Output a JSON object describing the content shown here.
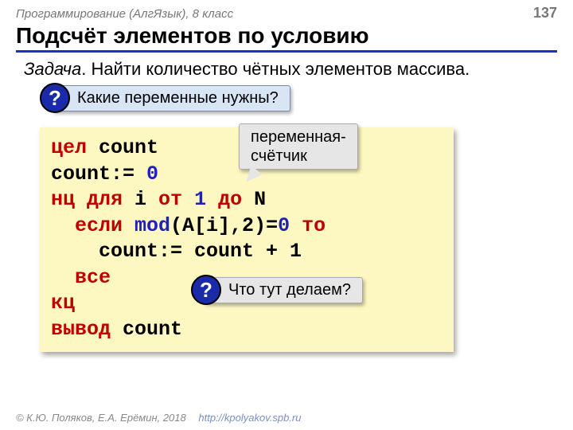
{
  "header": {
    "course": "Программирование (АлгЯзык), 8 класс",
    "page": "137"
  },
  "title": "Подсчёт элементов по условию",
  "task": {
    "label": "Задача",
    "text": ". Найти количество чётных элементов массива."
  },
  "callouts": {
    "q_glyph": "?",
    "c1_text": "Какие переменные нужны?",
    "c2_line1": "переменная-",
    "c2_line2": "счётчик",
    "c3_text": "Что тут делаем?"
  },
  "code": {
    "l1_kw": "цел ",
    "l1_rest": "count",
    "l2_a": "count:= ",
    "l2_b": "0",
    "l3_a": "нц для ",
    "l3_b": "i ",
    "l3_c": "от ",
    "l3_d": "1 ",
    "l3_e": "до ",
    "l3_f": "N",
    "l4_a": "  если ",
    "l4_b": "mod",
    "l4_c": "(A[i],2)=",
    "l4_d": "0",
    "l4_e": " то",
    "l5": "    count:= count + 1",
    "l6": "  все",
    "l7": "кц",
    "l8_a": "вывод ",
    "l8_b": "count"
  },
  "footer": {
    "copyright": "© К.Ю. Поляков, Е.А. Ерёмин, 2018",
    "url": "http://kpolyakov.spb.ru"
  }
}
